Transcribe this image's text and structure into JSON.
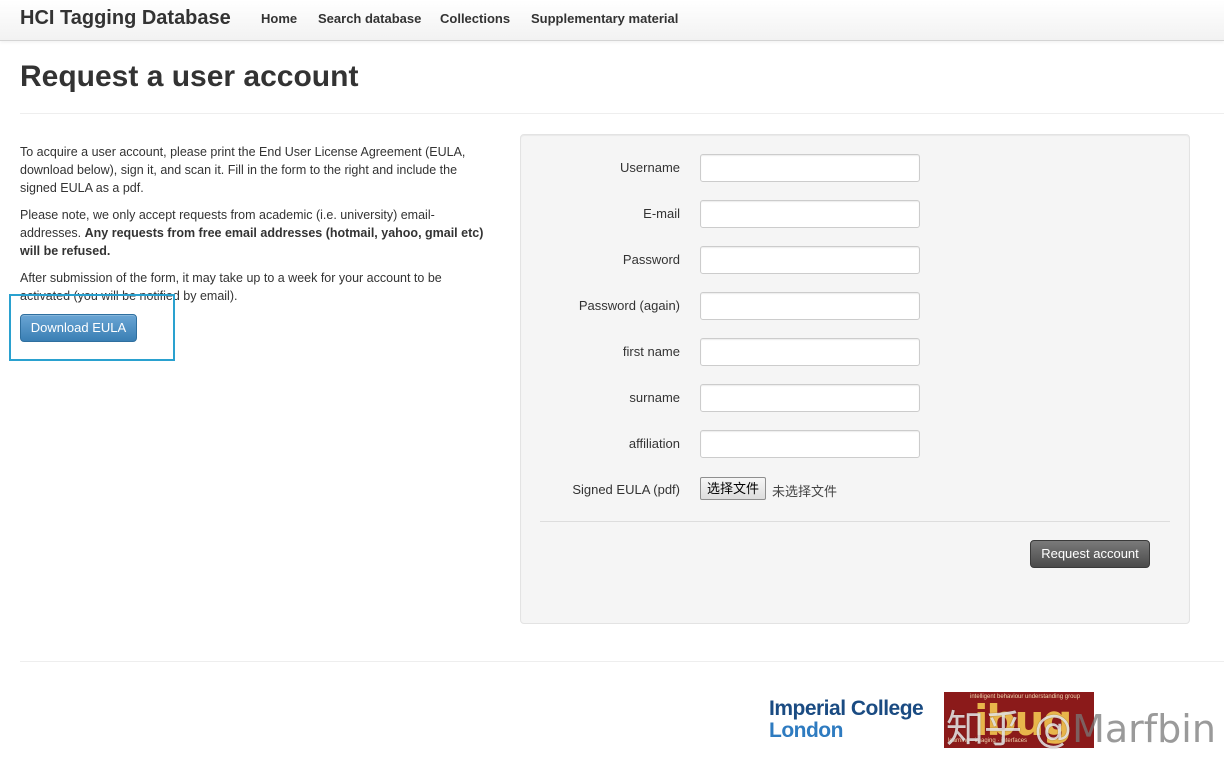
{
  "navbar": {
    "brand": "HCI Tagging Database",
    "links": [
      "Home",
      "Search database",
      "Collections",
      "Supplementary material"
    ]
  },
  "page": {
    "title": "Request a user account"
  },
  "intro": {
    "p1": "To acquire a user account, please print the End User License Agreement (EULA, download below), sign it, and scan it. Fill in the form to the right and include the signed EULA as a pdf.",
    "p2_plain": "Please note, we only accept requests from academic (i.e. university) email-addresses. ",
    "p2_bold": "Any requests from free email addresses (hotmail, yahoo, gmail etc) will be refused.",
    "p3": "After submission of the form, it may take up to a week for your account to be activated (you will be notified by email).",
    "download_button": "Download EULA"
  },
  "form": {
    "fields": [
      {
        "label": "Username",
        "value": ""
      },
      {
        "label": "E-mail",
        "value": ""
      },
      {
        "label": "Password",
        "value": ""
      },
      {
        "label": "Password (again)",
        "value": ""
      },
      {
        "label": "first name",
        "value": ""
      },
      {
        "label": "surname",
        "value": ""
      },
      {
        "label": "affiliation",
        "value": ""
      }
    ],
    "file_label": "Signed EULA (pdf)",
    "file_button": "选择文件",
    "file_status": "未选择文件",
    "submit_label": "Request account"
  },
  "footer": {
    "imperial_line1": "Imperial College",
    "imperial_line2": "London",
    "ibug_top": "intelligent behaviour understanding group",
    "ibug_word": "ibug",
    "ibug_bottom": "learning · imaging · interfaces",
    "watermark_glyphs": "知乎 @",
    "watermark_name": "Marfbin"
  },
  "colors": {
    "primary_button": "#3a7fb4",
    "dark_button": "#4a4a4a",
    "highlight_box": "#2aa1cf",
    "imperial_blue": "#1a4b82"
  }
}
